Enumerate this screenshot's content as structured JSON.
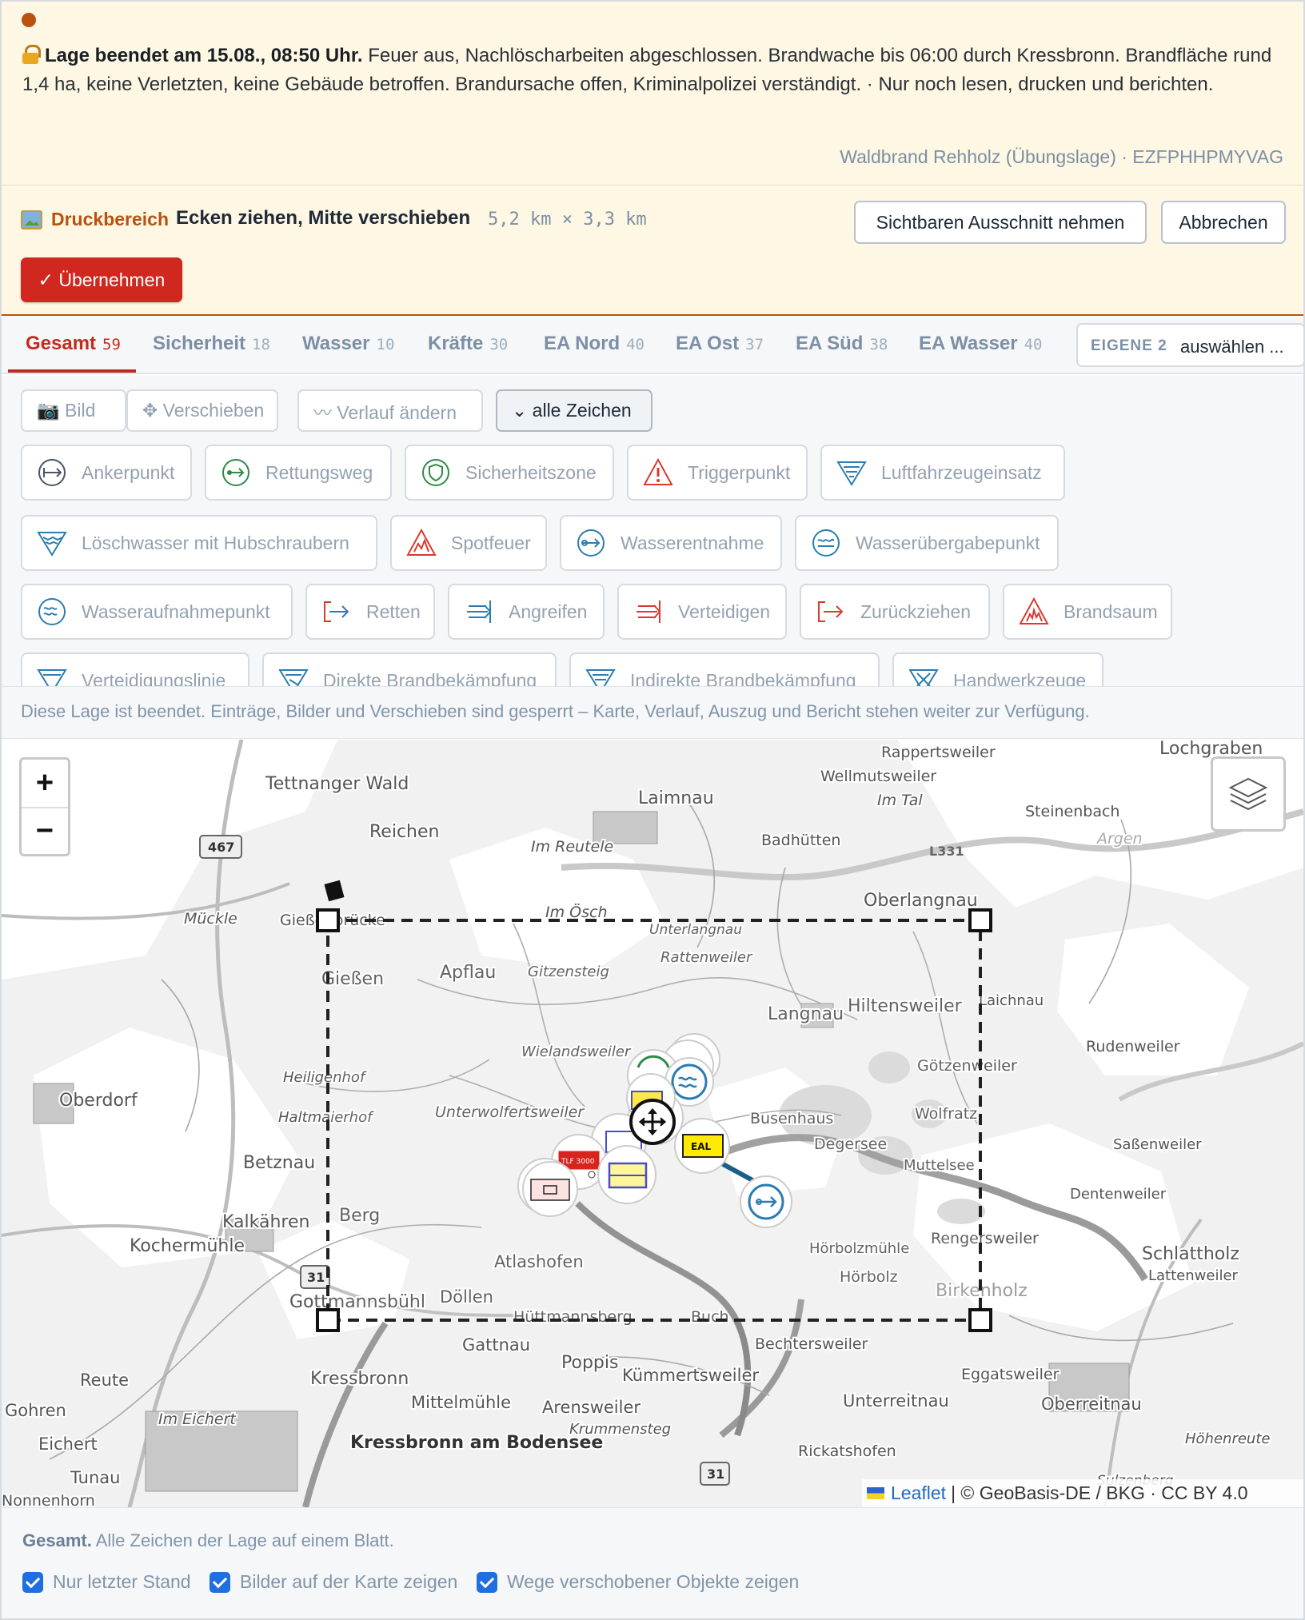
{
  "banner": {
    "status_bold": "Lage beendet am 15.08., 08:50 Uhr.",
    "status_text": "Feuer aus, Nachlöscharbeiten abgeschlossen. Brandwache bis 06:00 durch Kressbronn. Brandfläche rund 1,4 ha, keine Verletzten, keine Gebäude betroffen. Brandursache offen, Kriminalpolizei verständigt. · Nur noch lesen, drucken und berichten.",
    "lage_name": "Waldbrand Rehholz (Übungslage) · EZFPHHPMYVAG",
    "status_color": "#b9520f"
  },
  "print": {
    "label": "Druckbereich",
    "hint": "Ecken ziehen, Mitte verschieben",
    "size": "5,2 km × 3,3 km",
    "take_visible": "Sichtbaren Ausschnitt nehmen",
    "cancel": "Abbrechen",
    "apply": "✓ Übernehmen",
    "apply_color": "#d0281e"
  },
  "tabs": [
    {
      "label": "Gesamt",
      "count": "59"
    },
    {
      "label": "Sicherheit",
      "count": "18"
    },
    {
      "label": "Wasser",
      "count": "10"
    },
    {
      "label": "Kräfte",
      "count": "30"
    },
    {
      "label": "EA Nord",
      "count": "40"
    },
    {
      "label": "EA Ost",
      "count": "37"
    },
    {
      "label": "EA Süd",
      "count": "38"
    },
    {
      "label": "EA Wasser",
      "count": "40"
    }
  ],
  "eigene": {
    "label": "EIGENE 2",
    "select": "auswählen ..."
  },
  "tools": [
    "📷 Bild",
    "✥ Verschieben",
    "〰 Verlauf ändern",
    "⌄ alle Zeichen"
  ],
  "symbols": [
    {
      "label": "Ankerpunkt",
      "icon": "anchor-point-icon"
    },
    {
      "label": "Rettungsweg",
      "icon": "escape-route-icon"
    },
    {
      "label": "Sicherheitszone",
      "icon": "safety-zone-icon"
    },
    {
      "label": "Triggerpunkt",
      "icon": "trigger-point-icon"
    },
    {
      "label": "Luftfahrzeugeinsatz",
      "icon": "aircraft-operation-icon"
    },
    {
      "label": "Löschwasser mit Hubschraubern",
      "icon": "helicopter-water-icon"
    },
    {
      "label": "Spotfeuer",
      "icon": "spot-fire-icon"
    },
    {
      "label": "Wasserentnahme",
      "icon": "water-withdrawal-icon"
    },
    {
      "label": "Wasserübergabepunkt",
      "icon": "water-transfer-icon"
    },
    {
      "label": "Wasseraufnahmepunkt",
      "icon": "water-intake-icon"
    },
    {
      "label": "Retten",
      "icon": "rescue-arrow-icon"
    },
    {
      "label": "Angreifen",
      "icon": "attack-arrow-icon"
    },
    {
      "label": "Verteidigen",
      "icon": "defend-arrow-icon"
    },
    {
      "label": "Zurückziehen",
      "icon": "retreat-arrow-icon"
    },
    {
      "label": "Brandsaum",
      "icon": "fire-edge-icon"
    },
    {
      "label": "Verteidigungslinie",
      "icon": "defense-line-icon"
    },
    {
      "label": "Direkte Brandbekämpfung",
      "icon": "direct-attack-icon"
    },
    {
      "label": "Indirekte Brandbekämpfung",
      "icon": "indirect-attack-icon"
    },
    {
      "label": "Handwerkzeuge",
      "icon": "hand-tools-icon"
    }
  ],
  "locked_message": "Diese Lage ist beendet. Einträge, Bilder und Verschieben sind gesperrt – Karte, Verlauf, Auszug und Bericht stehen weiter zur Verfügung.",
  "map": {
    "zoom_in": "+",
    "zoom_out": "−",
    "places": [
      "Lochgraben",
      "Rappertsweiler",
      "Wellmutsweiler",
      "Tettnanger Wald",
      "Laimnau",
      "Im Tal",
      "Steinenbach",
      "Reichen",
      "Im Reutele",
      "Badhütten",
      "Argen",
      "Mückle",
      "Gießenbrücke",
      "Im Ösch",
      "Oberlangnau",
      "Unterlangnau",
      "Apflau",
      "Gitzensteig",
      "Rattenweiler",
      "Gießen",
      "Langnau",
      "Hiltensweiler",
      "Wielandsweiler",
      "Laichnau",
      "Heiligenhof",
      "Oberdorf",
      "Götzenweiler",
      "Rudenweiler",
      "Haltmaierhof",
      "Unterwolfertsweiler",
      "Busenhaus",
      "Wolfratz",
      "Degersee",
      "Saßenweiler",
      "Betznau",
      "Muttelsee",
      "Dentenweiler",
      "Kalkähren",
      "Berg",
      "Kochermühle",
      "Atlashofen",
      "Hörbolzmühle",
      "Rengersweiler",
      "Schlattholz",
      "Hörbolz",
      "Lattenweiler",
      "Gottmannsbühl",
      "Döllen",
      "Hüttmannsberg",
      "Buch",
      "Birkenholz",
      "Gattnau",
      "Bechtersweiler",
      "Reute",
      "Kressbronn",
      "Poppis",
      "Kümmertsweiler",
      "Eggatsweiler",
      "Gohren",
      "Mittelmühle",
      "Arensweiler",
      "Unterreitnau",
      "Oberreitnau",
      "Im Eichert",
      "Eichert",
      "Krummensteg",
      "Höhenreute",
      "Kressbronn am Bodensee",
      "Tunau",
      "Rickatshofen",
      "Sulzenberg",
      "Nonnenhorn"
    ],
    "roads": [
      "467",
      "L331",
      "31",
      "31"
    ],
    "marker_labels": [
      "EAL",
      "TLF 3000"
    ],
    "attribution_leaflet": "Leaflet",
    "attribution_rest": "| © GeoBasis-DE / BKG · CC BY 4.0"
  },
  "footer": {
    "bold": "Gesamt.",
    "text": "Alle Zeichen der Lage auf einem Blatt.",
    "checks": [
      "Nur letzter Stand",
      "Bilder auf der Karte zeigen",
      "Wege verschobener Objekte zeigen"
    ]
  }
}
